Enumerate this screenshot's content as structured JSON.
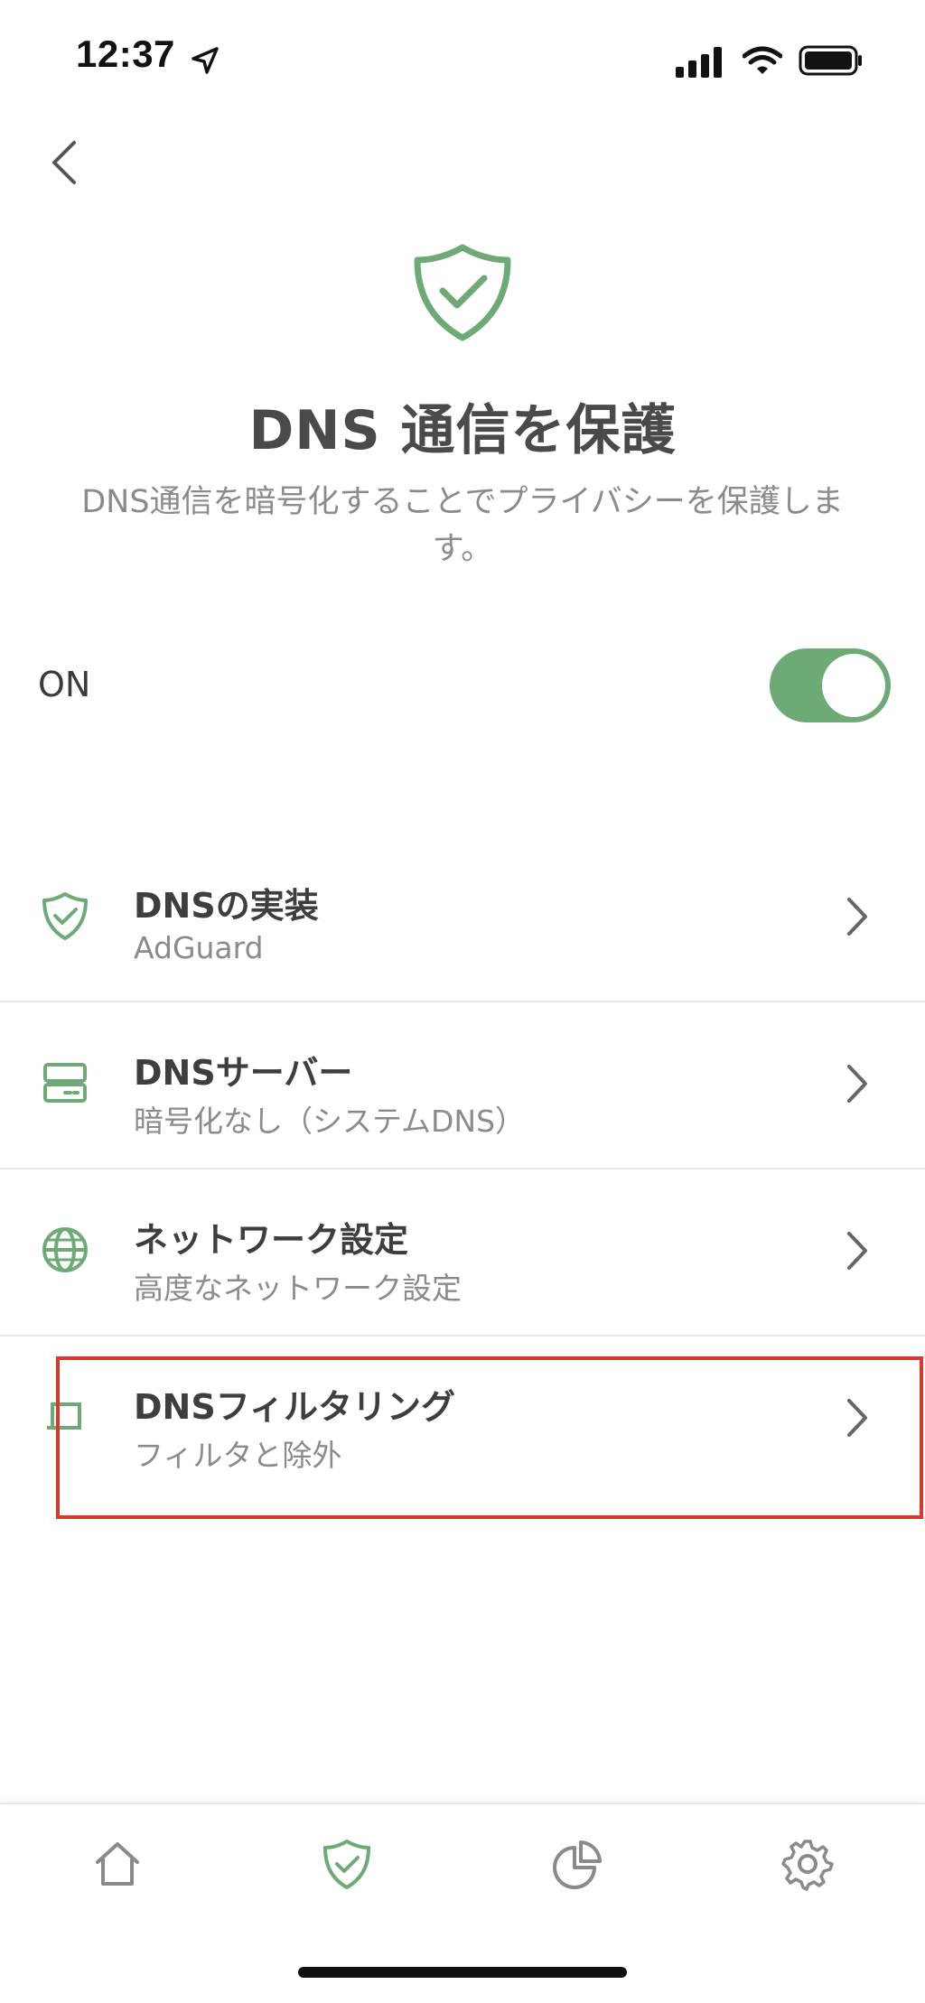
{
  "status_bar": {
    "time": "12:37"
  },
  "header": {
    "title": "DNS 通信を保護",
    "description": "DNS通信を暗号化することでプライバシーを保護します。"
  },
  "protection": {
    "label": "ON",
    "enabled": true
  },
  "menu": {
    "items": [
      {
        "title": "DNSの実装",
        "subtitle": "AdGuard",
        "icon": "shield-check-icon"
      },
      {
        "title": "DNSサーバー",
        "subtitle": "暗号化なし（システムDNS）",
        "icon": "server-icon"
      },
      {
        "title": "ネットワーク設定",
        "subtitle": "高度なネットワーク設定",
        "icon": "globe-icon"
      },
      {
        "title": "DNSフィルタリング",
        "subtitle": "フィルタと除外",
        "icon": "filter-icon"
      }
    ]
  },
  "tab_bar": {
    "tabs": [
      {
        "name": "home",
        "icon": "home-icon"
      },
      {
        "name": "protection",
        "icon": "shield-check-icon",
        "active": true
      },
      {
        "name": "statistics",
        "icon": "pie-chart-icon"
      },
      {
        "name": "settings",
        "icon": "gear-icon"
      }
    ]
  },
  "colors": {
    "accent": "#6daa76",
    "highlight": "#d63a2b",
    "text_primary": "#3e3e3e",
    "text_secondary": "#8b8b8b"
  }
}
